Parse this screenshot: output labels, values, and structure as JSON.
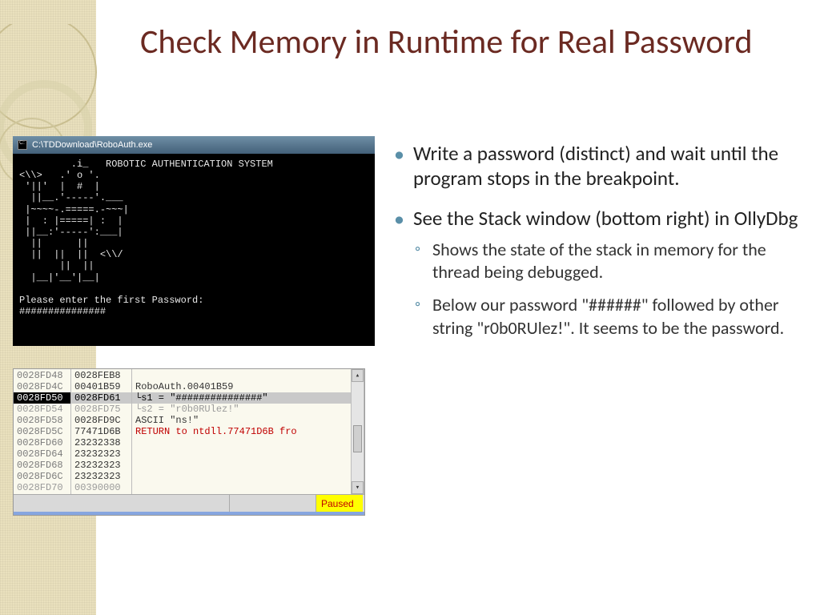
{
  "title": "Check Memory in Runtime for Real Password",
  "console": {
    "path": "C:\\TDDownload\\RoboAuth.exe",
    "header": "ROBOTIC AUTHENTICATION SYSTEM",
    "art": "         .i_\n<\\\\>   .' o '.\n '||'  |  #  |\n  ||__.'-----'.___\n |~~~~-.=====.-~~~|\n |  : |=====| :  |\n ||__:'-----':___|\n  ||      ||\n  ||  ||  ||  <\\\\/\n       ||  ||\n  |__|'__'|__|",
    "prompt": "Please enter the first Password:",
    "input": "###############"
  },
  "stack": {
    "rows": [
      {
        "addr": "0028FD48",
        "val": "0028FEB8",
        "desc": ""
      },
      {
        "addr": "0028FD4C",
        "val": "00401B59",
        "desc": "RoboAuth.00401B59"
      },
      {
        "addr": "0028FD50",
        "val": "0028FD61",
        "desc": "└s1 = \"###############\"",
        "hl": true
      },
      {
        "addr": "0028FD54",
        "val": "0028FD75",
        "desc": "└s2 = \"r0b0RUlez!\"",
        "gray": true
      },
      {
        "addr": "0028FD58",
        "val": "0028FD9C",
        "desc": "ASCII \"ns!\""
      },
      {
        "addr": "0028FD5C",
        "val": "77471D6B",
        "desc": "RETURN to ntdll.77471D6B fro",
        "red": true
      },
      {
        "addr": "0028FD60",
        "val": "23232338",
        "desc": ""
      },
      {
        "addr": "0028FD64",
        "val": "23232323",
        "desc": ""
      },
      {
        "addr": "0028FD68",
        "val": "23232323",
        "desc": ""
      },
      {
        "addr": "0028FD6C",
        "val": "23232323",
        "desc": ""
      },
      {
        "addr": "0028FD70",
        "val": "00390000",
        "desc": "",
        "gray": true
      }
    ],
    "status": "Paused"
  },
  "bullets": {
    "b1": "Write a password (distinct) and wait until the program stops in the breakpoint.",
    "b2": " See the Stack window (bottom right) in OllyDbg",
    "s1": "Shows the state of the stack in memory for the thread being debugged.",
    "s2": "Below our password \"######\" followed by other string \"r0b0RUlez!\". It seems to be the password."
  }
}
